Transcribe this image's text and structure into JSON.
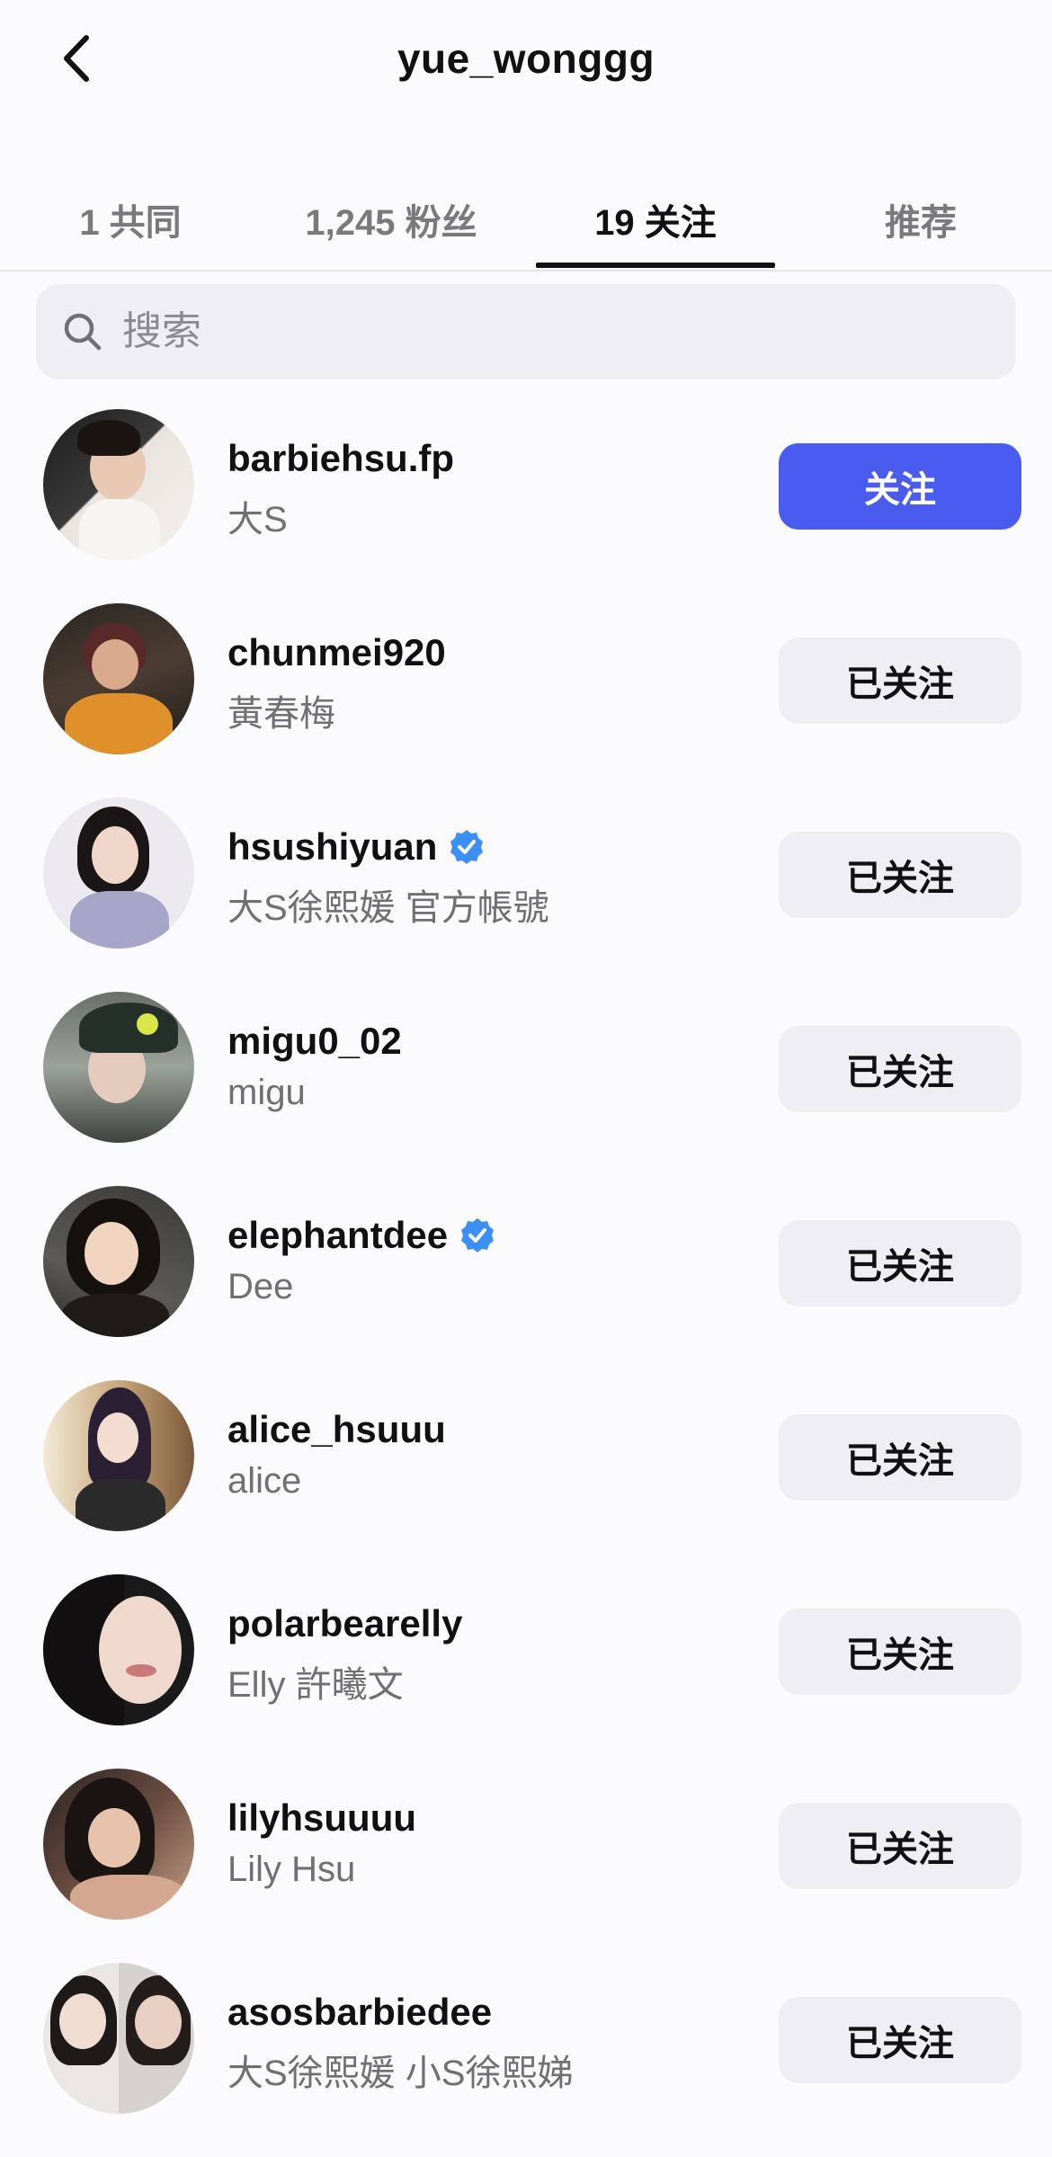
{
  "header": {
    "title": "yue_wonggg"
  },
  "tabs": [
    {
      "label": "1 共同"
    },
    {
      "label": "1,245 粉丝"
    },
    {
      "label": "19 关注"
    },
    {
      "label": "推荐"
    }
  ],
  "search": {
    "placeholder": "搜索"
  },
  "users": [
    {
      "username": "barbiehsu.fp",
      "name": "大S",
      "button": "关注",
      "verified": false
    },
    {
      "username": "chunmei920",
      "name": "黃春梅",
      "button": "已关注",
      "verified": false
    },
    {
      "username": "hsushiyuan",
      "name": "大S徐熙媛  官方帳號",
      "button": "已关注",
      "verified": true
    },
    {
      "username": "migu0_02",
      "name": "migu",
      "button": "已关注",
      "verified": false
    },
    {
      "username": "elephantdee",
      "name": "Dee",
      "button": "已关注",
      "verified": true
    },
    {
      "username": "alice_hsuuu",
      "name": "alice",
      "button": "已关注",
      "verified": false
    },
    {
      "username": "polarbearelly",
      "name": "Elly 許曦文",
      "button": "已关注",
      "verified": false
    },
    {
      "username": "lilyhsuuuu",
      "name": "Lily Hsu",
      "button": "已关注",
      "verified": false
    },
    {
      "username": "asosbarbiedee",
      "name": "大S徐熙媛 小S徐熙娣",
      "button": "已关注",
      "verified": false
    }
  ],
  "colors": {
    "accent": "#4a5cf0",
    "verified": "#3b8ff5"
  }
}
